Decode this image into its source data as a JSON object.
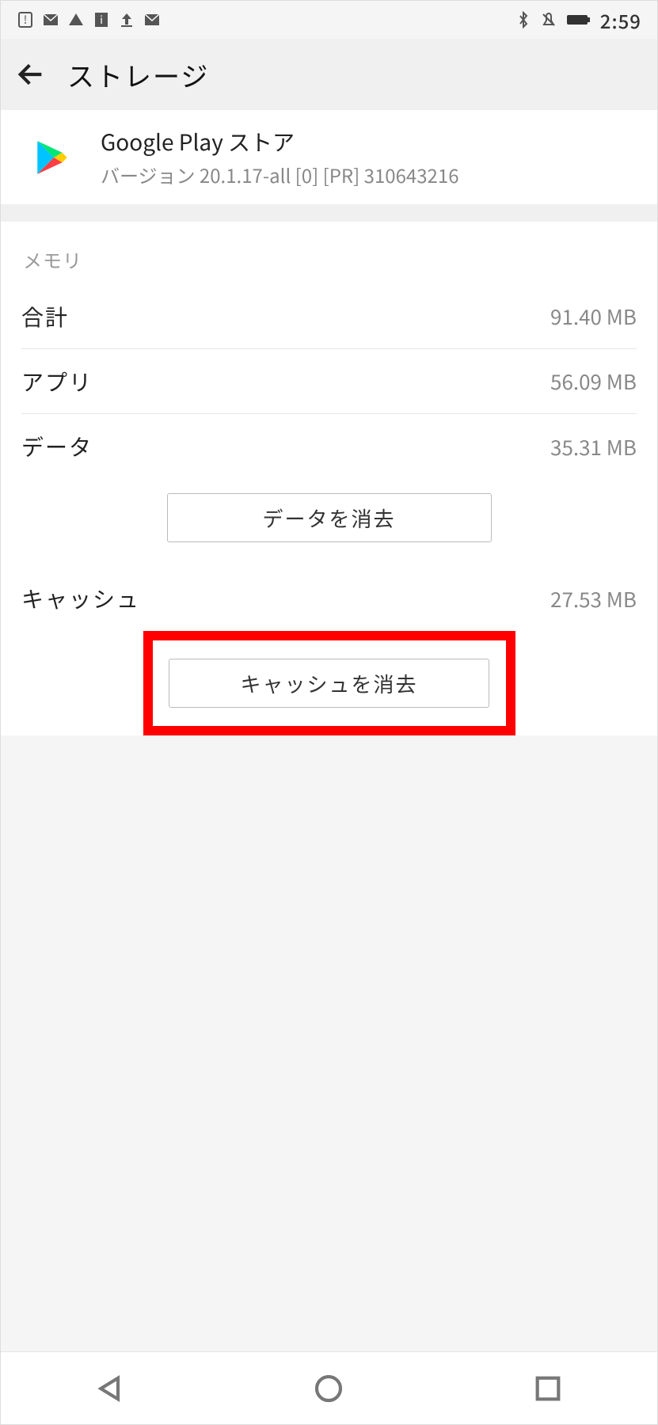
{
  "statusbar": {
    "clock": "2:59"
  },
  "title": "ストレージ",
  "app": {
    "name": "Google Play ストア",
    "version": "バージョン 20.1.17-all [0] [PR] 310643216"
  },
  "memory": {
    "section_label": "メモリ",
    "rows": {
      "total": {
        "label": "合計",
        "value": "91.40 MB"
      },
      "app": {
        "label": "アプリ",
        "value": "56.09 MB"
      },
      "data": {
        "label": "データ",
        "value": "35.31 MB"
      },
      "cache": {
        "label": "キャッシュ",
        "value": "27.53 MB"
      }
    },
    "buttons": {
      "clear_data": "データを消去",
      "clear_cache": "キャッシュを消去"
    }
  }
}
